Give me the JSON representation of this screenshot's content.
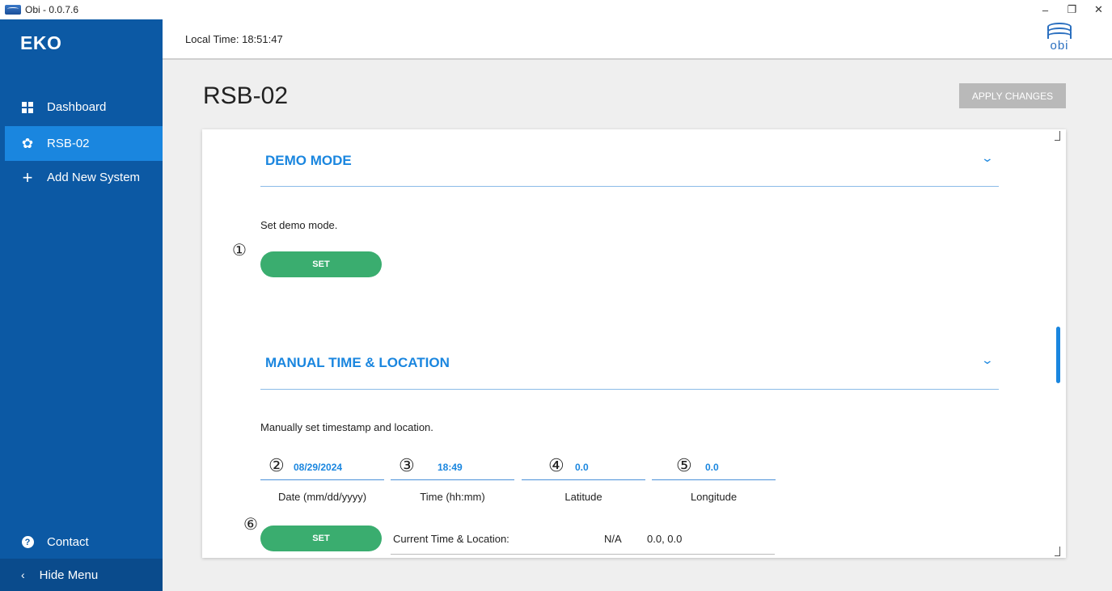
{
  "window": {
    "title": "Obi - 0.0.7.6",
    "controls": [
      "–",
      "❐",
      "✕"
    ]
  },
  "sidebar": {
    "logo": "EKO",
    "items": [
      {
        "label": "Dashboard",
        "icon": "dashboard-icon"
      },
      {
        "label": "RSB-02",
        "icon": "gear-icon",
        "active": true
      },
      {
        "label": "Add New System",
        "icon": "plus-icon"
      }
    ],
    "contact": "Contact",
    "hide_menu": "Hide Menu"
  },
  "header": {
    "local_time": "Local Time: 18:51:47",
    "logo_text": "obi"
  },
  "page": {
    "title": "RSB-02",
    "apply_label": "APPLY CHANGES"
  },
  "demo_mode": {
    "title": "DEMO MODE",
    "description": "Set demo mode.",
    "marker": "①",
    "set_label": "SET"
  },
  "manual": {
    "title": "MANUAL TIME & LOCATION",
    "description": "Manually set timestamp and location.",
    "fields": [
      {
        "marker": "②",
        "value": "08/29/2024",
        "label": "Date (mm/dd/yyyy)"
      },
      {
        "marker": "③",
        "value": "18:49",
        "label": "Time (hh:mm)"
      },
      {
        "marker": "④",
        "value": "0.0",
        "label": "Latitude"
      },
      {
        "marker": "⑤",
        "value": "0.0",
        "label": "Longitude"
      }
    ],
    "set_marker": "⑥",
    "set_label": "SET",
    "current_label": "Current Time & Location:",
    "current_time": "N/A",
    "current_coords": "0.0, 0.0"
  },
  "colors": {
    "sidebar": "#0c59a4",
    "active_nav": "#1a86df",
    "accent": "#1a86df",
    "set_button": "#3aad6f",
    "apply_button": "#b9b9b9"
  }
}
